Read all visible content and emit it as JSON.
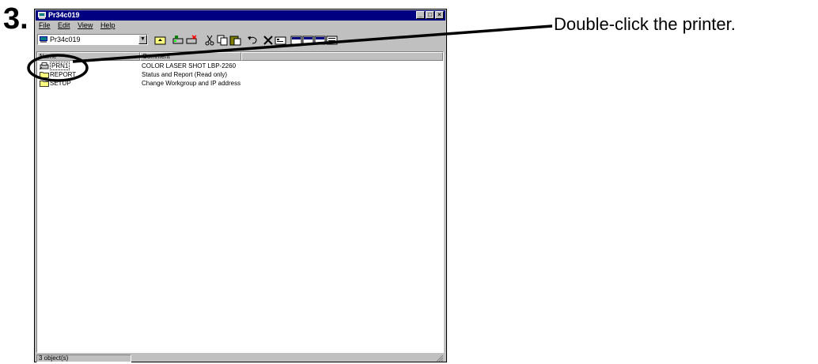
{
  "step": {
    "number": "3."
  },
  "instruction": {
    "text": "Double-click the printer."
  },
  "window": {
    "title": "Pr34c019",
    "buttons": {
      "minimize": "_",
      "maximize": "□",
      "close": "×"
    },
    "menu": [
      "File",
      "Edit",
      "View",
      "Help"
    ],
    "address": {
      "value": "Pr34c019"
    },
    "toolbar_icons": [
      "up-folder-icon",
      "map-drive-icon",
      "disconnect-drive-icon",
      "cut-icon",
      "copy-icon",
      "paste-icon",
      "undo-icon",
      "delete-icon",
      "properties-icon",
      "large-icons-icon",
      "small-icons-icon",
      "list-icon",
      "details-icon"
    ],
    "columns": [
      "Name",
      "Comment"
    ],
    "items": [
      {
        "name": "PRN1",
        "comment": "COLOR LASER SHOT LBP-2260",
        "icon": "printer-icon",
        "selected": true
      },
      {
        "name": "REPORT",
        "comment": "Status and Report (Read only)",
        "icon": "folder-icon",
        "selected": false
      },
      {
        "name": "SETUP",
        "comment": "Change Workgroup and IP address",
        "icon": "folder-icon",
        "selected": false
      }
    ],
    "status": "3 object(s)"
  },
  "colors": {
    "titlebar": "#000080",
    "face": "#c0c0c0",
    "folder": "#ffff80"
  }
}
